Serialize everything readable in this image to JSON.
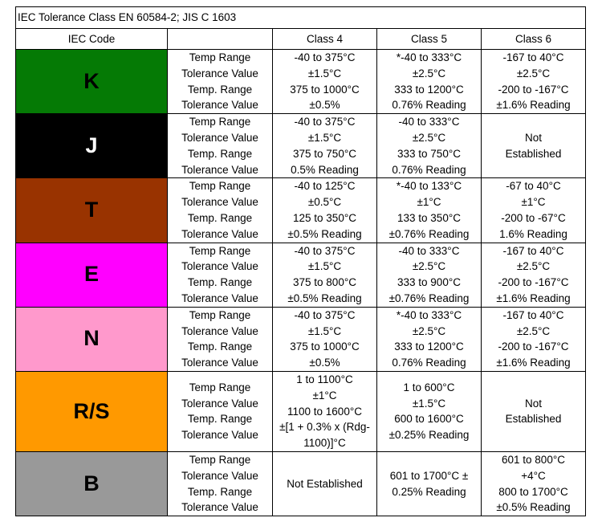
{
  "title": "IEC Tolerance Class EN 60584-2; JIS C 1603",
  "header": {
    "code": "IEC Code",
    "blank": "",
    "class4": "Class 4",
    "class5": "Class 5",
    "class6": "Class 6"
  },
  "labels": [
    "Temp Range",
    "Tolerance Value",
    "Temp. Range",
    "Tolerance Value"
  ],
  "rows": [
    {
      "code": "K",
      "bg": "#057a05",
      "fg": "#000000",
      "class4": [
        "-40 to 375°C",
        "±1.5°C",
        "375 to 1000°C",
        "±0.5%"
      ],
      "class5": [
        "*-40 to 333°C",
        "±2.5°C",
        "333 to 1200°C",
        "0.76% Reading"
      ],
      "class6": [
        "-167 to 40°C",
        "±2.5°C",
        "-200 to -167°C",
        "±1.6% Reading"
      ]
    },
    {
      "code": "J",
      "bg": "#000000",
      "fg": "#ffffff",
      "class4": [
        "-40 to 375°C",
        "±1.5°C",
        "375 to 750°C",
        "0.5% Reading"
      ],
      "class5": [
        "-40 to 333°C",
        "±2.5°C",
        "333 to 750°C",
        "0.76% Reading"
      ],
      "class6": [
        "Not",
        "Established"
      ]
    },
    {
      "code": "T",
      "bg": "#993300",
      "fg": "#000000",
      "class4": [
        "-40 to 125°C",
        "±0.5°C",
        "125 to 350°C",
        "±0.5% Reading"
      ],
      "class5": [
        "*-40 to 133°C",
        "±1°C",
        "133 to 350°C",
        "±0.76% Reading"
      ],
      "class6": [
        "-67 to 40°C",
        "±1°C",
        "-200 to -67°C",
        "1.6% Reading"
      ]
    },
    {
      "code": "E",
      "bg": "#ff00ff",
      "fg": "#000000",
      "class4": [
        "-40 to 375°C",
        "±1.5°C",
        "375 to 800°C",
        "±0.5% Reading"
      ],
      "class5": [
        "-40 to 333°C",
        "±2.5°C",
        "333 to 900°C",
        "±0.76% Reading"
      ],
      "class6": [
        "-167 to 40°C",
        "±2.5°C",
        "-200 to -167°C",
        "±1.6% Reading"
      ]
    },
    {
      "code": "N",
      "bg": "#ff99cc",
      "fg": "#000000",
      "class4": [
        "-40 to 375°C",
        "±1.5°C",
        "375 to 1000°C",
        "±0.5%"
      ],
      "class5": [
        "*-40 to 333°C",
        "±2.5°C",
        "333 to 1200°C",
        "0.76% Reading"
      ],
      "class6": [
        "-167 to 40°C",
        "±2.5°C",
        "-200 to -167°C",
        "±1.6% Reading"
      ]
    },
    {
      "code": "R/S",
      "bg": "#ff9900",
      "fg": "#000000",
      "class4": [
        "1 to 1100°C",
        "±1°C",
        "1100 to 1600°C",
        "±[1 + 0.3% x (Rdg-",
        "1100)]°C"
      ],
      "class5": [
        "1 to 600°C",
        "±1.5°C",
        "600 to 1600°C",
        "±0.25% Reading"
      ],
      "class6": [
        "Not",
        "Established"
      ]
    },
    {
      "code": "B",
      "bg": "#999999",
      "fg": "#000000",
      "class4": [
        "Not Established"
      ],
      "class5": [
        "601 to 1700°C ±",
        "0.25% Reading"
      ],
      "class6": [
        "601 to 800°C",
        "+4°C",
        "800 to 1700°C",
        "±0.5% Reading"
      ]
    }
  ]
}
